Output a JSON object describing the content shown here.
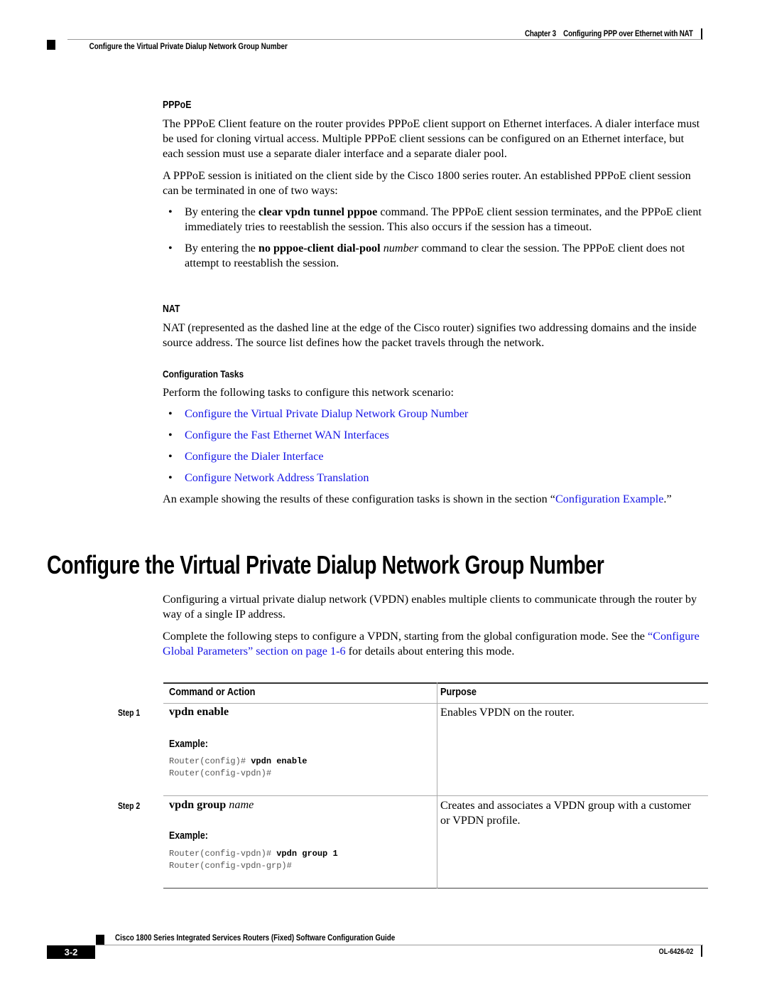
{
  "header": {
    "chapter": "Chapter 3",
    "chapter_title": "Configuring PPP over Ethernet with NAT",
    "section": "Configure the Virtual Private Dialup Network Group Number"
  },
  "pppoe": {
    "heading": "PPPoE",
    "para1": "The PPPoE Client feature on the router provides PPPoE client support on Ethernet interfaces. A dialer interface must be used for cloning virtual access. Multiple PPPoE client sessions can be configured on an Ethernet interface, but each session must use a separate dialer interface and a separate dialer pool.",
    "para2": "A PPPoE session is initiated on the client side by the Cisco 1800 series router. An established PPPoE client session can be terminated in one of two ways:",
    "bullet1": {
      "pre": "By entering the ",
      "cmd": "clear vpdn tunnel pppoe",
      "post": " command. The PPPoE client session terminates, and the PPPoE client immediately tries to reestablish the session. This also occurs if the session has a timeout."
    },
    "bullet2": {
      "pre": "By entering the ",
      "cmd": "no pppoe-client dial-pool",
      "arg": "number",
      "post": " command to clear the session. The PPPoE client does not attempt to reestablish the session."
    }
  },
  "nat": {
    "heading": "NAT",
    "para": "NAT (represented as the dashed line at the edge of the Cisco router) signifies two addressing domains and the inside source address. The source list defines how the packet travels through the network."
  },
  "config_tasks": {
    "heading": "Configuration Tasks",
    "intro": "Perform the following tasks to configure this network scenario:",
    "links": [
      "Configure the Virtual Private Dialup Network Group Number",
      "Configure the Fast Ethernet WAN Interfaces",
      "Configure the Dialer Interface",
      "Configure Network Address Translation"
    ],
    "example_pre": "An example showing the results of these configuration tasks is shown in the section “",
    "example_link1": "Configuration",
    "example_link2": "Example",
    "example_post": ".”"
  },
  "main": {
    "title": "Configure the Virtual Private Dialup Network Group Number",
    "para1": "Configuring a virtual private dialup network (VPDN) enables multiple clients to communicate through the router by way of a single IP address.",
    "para2_pre": "Complete the following steps to configure a VPDN, starting from the global configuration mode. See the ",
    "para2_link": "“Configure Global Parameters” section on page 1-6",
    "para2_post": " for details about entering this mode."
  },
  "table": {
    "col1": "Command or Action",
    "col2": "Purpose",
    "steps": [
      {
        "label": "Step 1",
        "cmd": "vpdn enable",
        "arg": "",
        "example_label": "Example:",
        "code1_prompt": "Router(config)# ",
        "code1_cmd": "vpdn enable",
        "code2": "Router(config-vpdn)#",
        "purpose": "Enables VPDN on the router."
      },
      {
        "label": "Step 2",
        "cmd": "vpdn group",
        "arg": "name",
        "example_label": "Example:",
        "code1_prompt": "Router(config-vpdn)# ",
        "code1_cmd": "vpdn group 1",
        "code2": "Router(config-vpdn-grp)#",
        "purpose": "Creates and associates a VPDN group with a customer or VPDN profile."
      }
    ]
  },
  "footer": {
    "title": "Cisco 1800 Series Integrated Services Routers (Fixed) Software Configuration Guide",
    "page": "3-2",
    "doc_id": "OL-6426-02"
  },
  "colors": {
    "link": "#1414e6",
    "text": "#000000",
    "rule": "#9a9a9a"
  }
}
